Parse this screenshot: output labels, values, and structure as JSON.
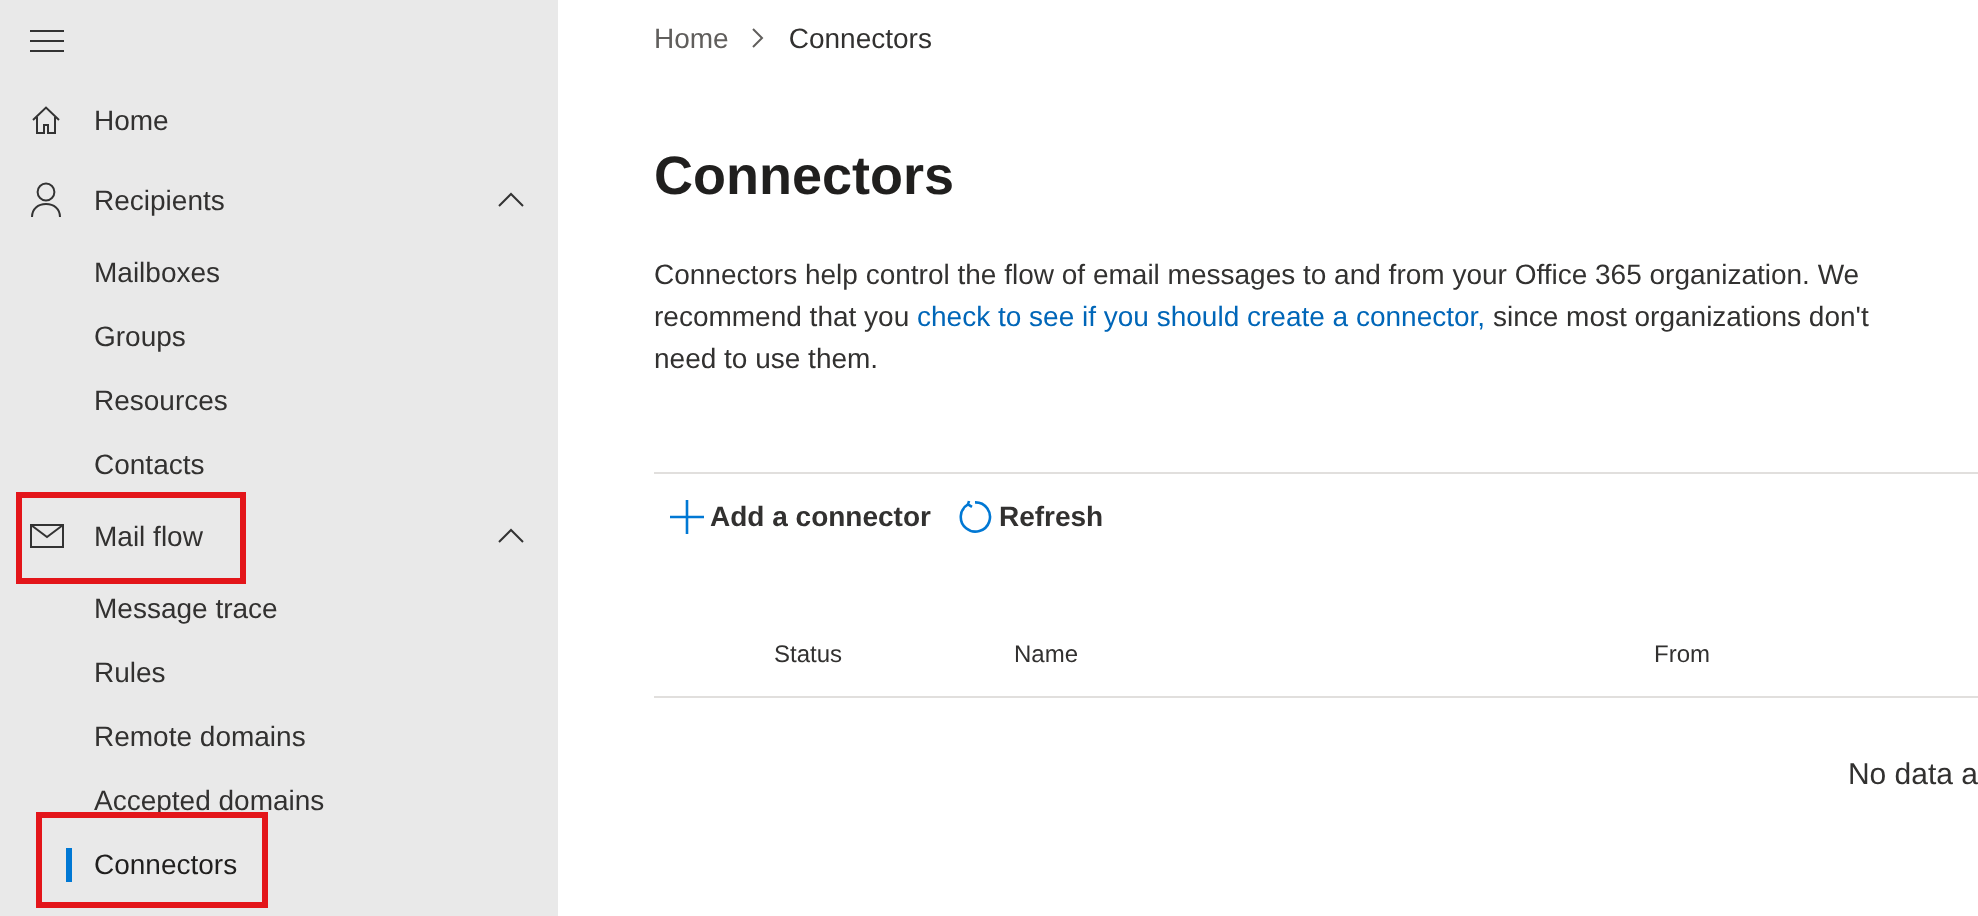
{
  "sidebar": {
    "items": [
      {
        "label": "Home",
        "kind": "home",
        "highlighted": false
      },
      {
        "label": "Recipients",
        "kind": "person",
        "expanded": true,
        "highlighted": false,
        "children": [
          {
            "label": "Mailboxes",
            "selected": false,
            "highlighted": false
          },
          {
            "label": "Groups",
            "selected": false,
            "highlighted": false
          },
          {
            "label": "Resources",
            "selected": false,
            "highlighted": false
          },
          {
            "label": "Contacts",
            "selected": false,
            "highlighted": false
          }
        ]
      },
      {
        "label": "Mail flow",
        "kind": "mail",
        "expanded": true,
        "highlighted": true,
        "children": [
          {
            "label": "Message trace",
            "selected": false,
            "highlighted": false
          },
          {
            "label": "Rules",
            "selected": false,
            "highlighted": false
          },
          {
            "label": "Remote domains",
            "selected": false,
            "highlighted": false
          },
          {
            "label": "Accepted domains",
            "selected": false,
            "highlighted": false
          },
          {
            "label": "Connectors",
            "selected": true,
            "highlighted": true
          }
        ]
      }
    ]
  },
  "breadcrumb": [
    "Home",
    "Connectors"
  ],
  "title": "Connectors",
  "description": {
    "before": "Connectors help control the flow of email messages to and from your Office 365 organization. We recommend that you ",
    "link": "check to see if you should create a connector,",
    "after": " since most organizations don't need to use them."
  },
  "toolbar": [
    {
      "label": "Add a connector",
      "kind": "add"
    },
    {
      "label": "Refresh",
      "kind": "refresh"
    }
  ],
  "table": {
    "columns": [
      "Status",
      "Name",
      "From"
    ],
    "empty_message": "No data a"
  }
}
